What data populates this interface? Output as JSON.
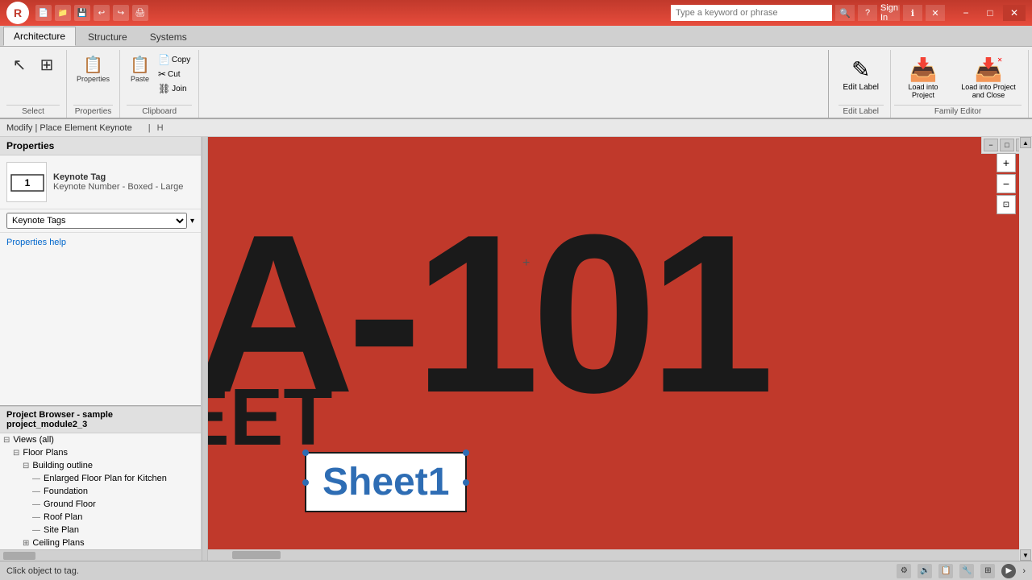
{
  "titleBar": {
    "logoText": "R",
    "searchPlaceholder": "Type a keyword or phrase",
    "signIn": "Sign In",
    "windowControls": [
      "−",
      "□",
      "✕"
    ]
  },
  "ribbonTabs": {
    "active": "Architecture",
    "tabs": [
      "Architecture",
      "Structure",
      "Systems"
    ]
  },
  "ribbon": {
    "selectGroup": {
      "label": "Select",
      "modifyLabel": "Modify",
      "dropdownArrow": "▾"
    },
    "propertiesGroup": {
      "label": "Properties",
      "btnLabel": "Properties"
    },
    "clipboardGroup": {
      "label": "Clipboard",
      "paste": "Paste",
      "copy": "Copy",
      "cut": "Cut",
      "join": "Join"
    }
  },
  "familyEditor": {
    "label": "Family Editor",
    "editLabel": {
      "icon": "✎",
      "label": "Edit\nLabel"
    },
    "loadIntoProject": {
      "icon": "📥",
      "label": "Load into\nProject"
    },
    "loadIntoProjectAndClose": {
      "icon": "📥",
      "label": "Load into\nProject and Close"
    }
  },
  "breadcrumb": {
    "text": "Modify | Place Element Keynote"
  },
  "properties": {
    "header": "Properties",
    "typeName": "Keynote Tag",
    "typeSubName": "Keynote Number - Boxed - Large",
    "filterLabel": "Keynote Tags",
    "helpLink": "Properties help"
  },
  "projectBrowser": {
    "header": "Project Browser - sample project_module2_3",
    "tree": [
      {
        "level": 0,
        "expand": "⊟",
        "text": "Views (all)"
      },
      {
        "level": 1,
        "expand": "⊟",
        "text": "Floor Plans"
      },
      {
        "level": 2,
        "expand": "⊟",
        "text": "Building outline"
      },
      {
        "level": 3,
        "expand": "—",
        "text": "Enlarged Floor Plan for Kitchen"
      },
      {
        "level": 3,
        "expand": "—",
        "text": "Foundation"
      },
      {
        "level": 3,
        "expand": "—",
        "text": "Ground Floor"
      },
      {
        "level": 3,
        "expand": "—",
        "text": "Roof Plan"
      },
      {
        "level": 3,
        "expand": "—",
        "text": "Site Plan"
      },
      {
        "level": 2,
        "expand": "⊞",
        "text": "Ceiling Plans"
      }
    ]
  },
  "canvas": {
    "bigText": "A-101",
    "sheetText": "EET",
    "sheet1Label": "Sheet1",
    "backgroundColor": "#c0392b"
  },
  "statusBar": {
    "message": "Click object to tag.",
    "icons": [
      "⚙",
      "🔊",
      "📋",
      "🔧",
      "⊞",
      "▶"
    ]
  }
}
